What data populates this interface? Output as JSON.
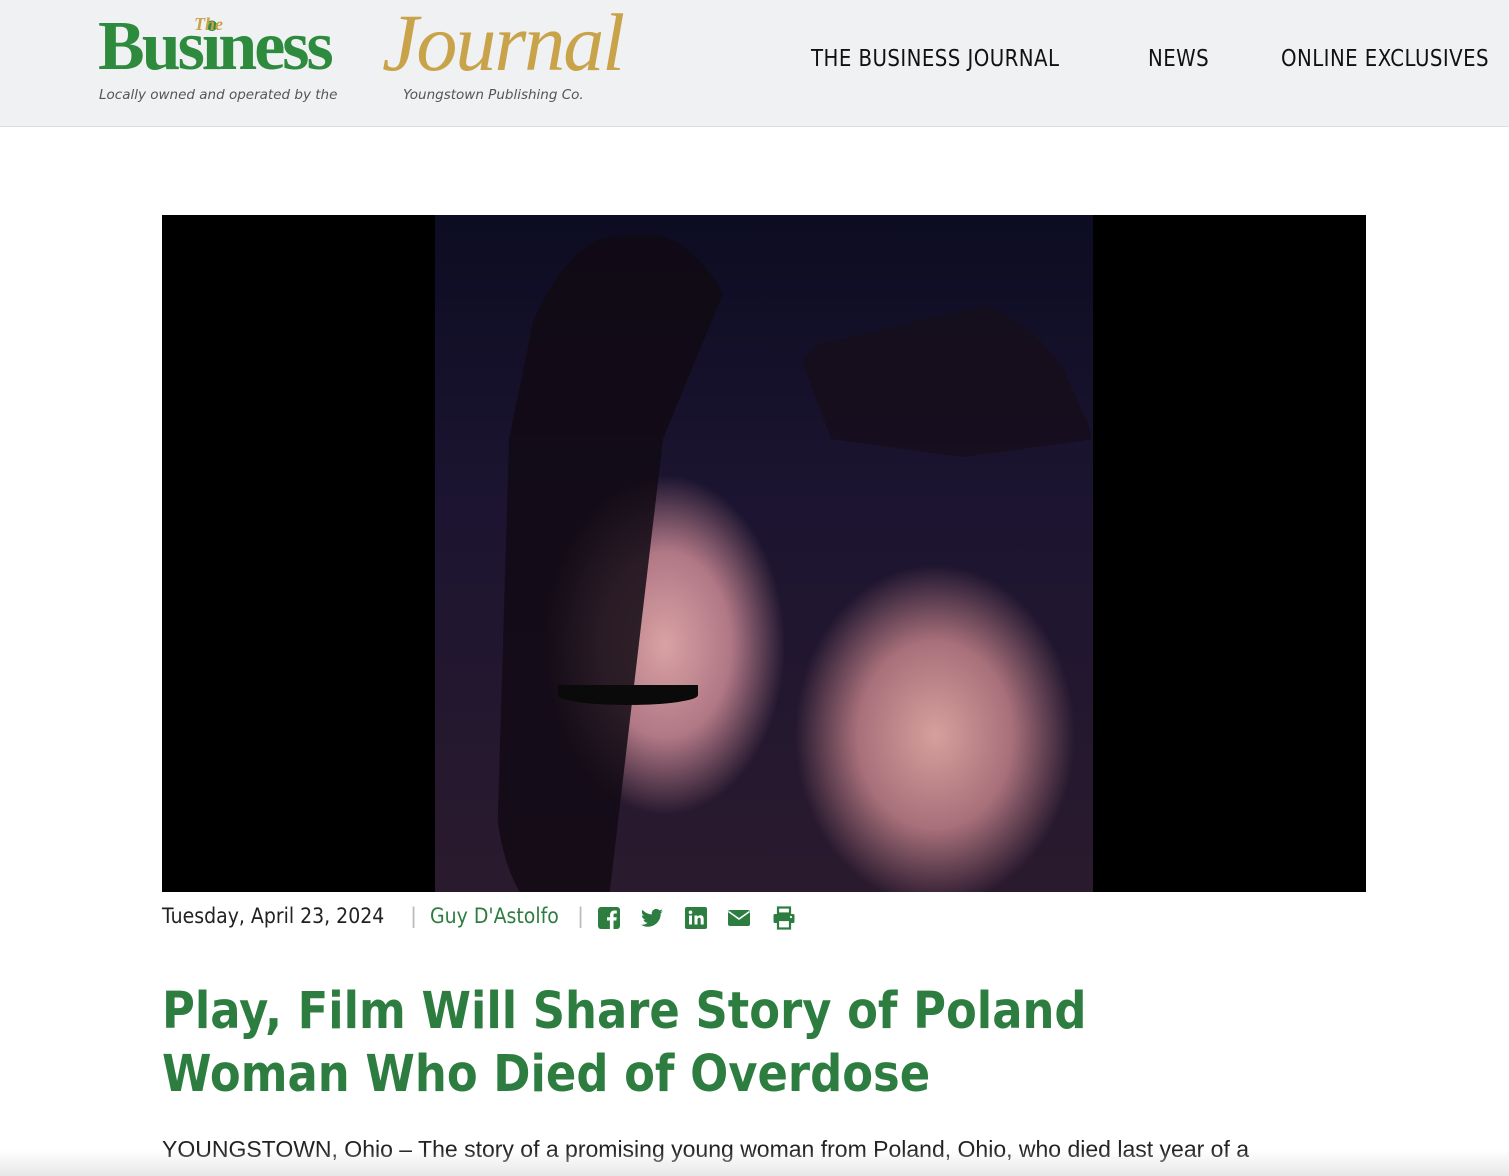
{
  "header": {
    "logo": {
      "the": "The",
      "business": "Business",
      "journal": "Journal",
      "tagline_left": "Locally owned and operated by the",
      "tagline_right": "Youngstown Publishing Co."
    },
    "nav": [
      {
        "label": "THE BUSINESS JOURNAL"
      },
      {
        "label": "NEWS"
      },
      {
        "label": "ONLINE EXCLUSIVES"
      }
    ]
  },
  "article": {
    "date": "Tuesday, April 23, 2024",
    "separator": "|",
    "author": "Guy D'Astolfo",
    "share_icons": [
      "facebook-icon",
      "twitter-icon",
      "linkedin-icon",
      "email-icon",
      "print-icon"
    ],
    "headline": "Play, Film Will Share Story of Poland Woman Who Died of Overdose",
    "lede": "YOUNGSTOWN, Ohio – The story of a promising young woman from Poland, Ohio, who died last year of a"
  },
  "colors": {
    "brand_green": "#2e7d40",
    "logo_green": "#2e8b3e",
    "logo_gold": "#c9a34a",
    "header_bg": "#eff1f3"
  }
}
